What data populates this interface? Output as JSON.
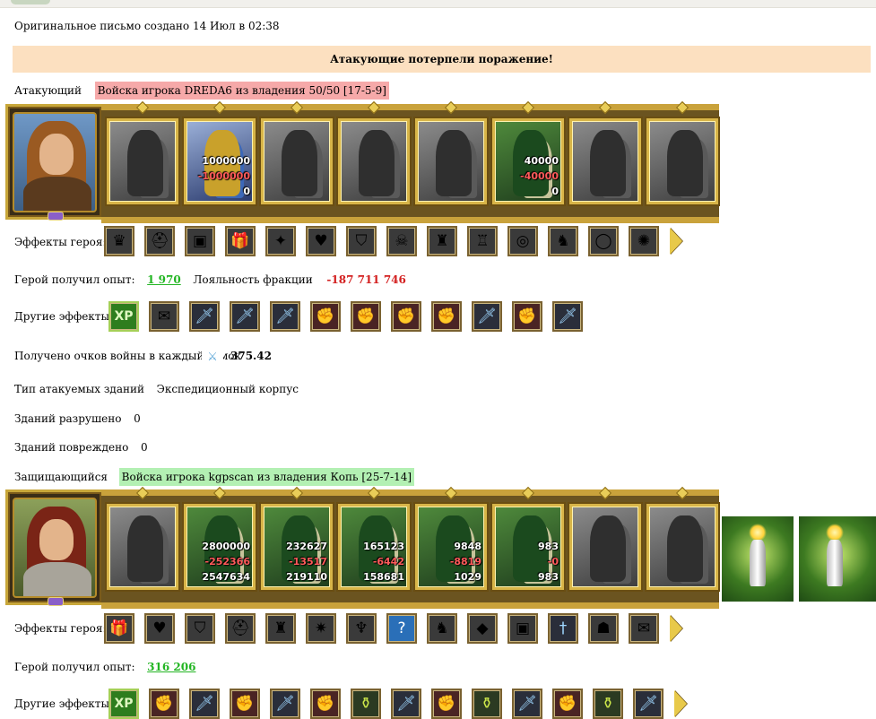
{
  "header": {
    "created": "Оригинальное письмо создано 14 Июл в 02:38"
  },
  "banner": {
    "text": "Атакующие потерпели поражение!"
  },
  "attacker": {
    "label": "Атакующий",
    "army": "Войска игрока DREDA6 из владения 50/50 [17-5-9]",
    "units": [
      {
        "style": "gray",
        "n1": "",
        "n2": "",
        "n3": ""
      },
      {
        "style": "yellow",
        "n1": "1000000",
        "n2": "-1000000",
        "n3": "0"
      },
      {
        "style": "gray",
        "n1": "",
        "n2": "",
        "n3": ""
      },
      {
        "style": "gray",
        "n1": "",
        "n2": "",
        "n3": ""
      },
      {
        "style": "gray",
        "n1": "",
        "n2": "",
        "n3": ""
      },
      {
        "style": "color",
        "n1": "40000",
        "n2": "-40000",
        "n3": "0"
      },
      {
        "style": "gray",
        "n1": "",
        "n2": "",
        "n3": ""
      },
      {
        "style": "gray",
        "n1": "",
        "n2": "",
        "n3": ""
      }
    ],
    "hero_effects_label": "Эффекты героя:",
    "hero_effect_icons": [
      "gem-crown-icon",
      "helmet-icon",
      "chest-icon",
      "gift-icon",
      "treasure-icon",
      "heart-icon",
      "shield-icon",
      "skull-icon",
      "armor-icon",
      "cuirass-icon",
      "ring-icon",
      "boots-icon",
      "bracelet-icon",
      "scarab-icon"
    ],
    "exp_label": "Герой получил опыт:",
    "exp_value": "1 970",
    "loyalty_label": "Лояльность фракции",
    "loyalty_value": "-187 711 746",
    "other_label": "Другие эффекты:",
    "other_icons": [
      "xp-icon",
      "scroll-icon",
      "sword-icon",
      "sword-icon",
      "sword-icon",
      "fist-icon",
      "fist-icon",
      "fist-icon",
      "fist-icon",
      "sword-icon",
      "fist-icon",
      "sword-icon"
    ],
    "war_points_label": "Получено очков войны в каждый замок",
    "war_points_value": "375.42",
    "building_type_label": "Тип атакуемых зданий",
    "building_type_value": "Экспедиционный корпус",
    "destroyed_label": "Зданий разрушено",
    "destroyed_value": "0",
    "damaged_label": "Зданий повреждено",
    "damaged_value": "0"
  },
  "defender": {
    "label": "Защищающийся",
    "army": "Войска игрока kgpscan из владения Копь [25-7-14]",
    "units": [
      {
        "style": "gray",
        "n1": "",
        "n2": "",
        "n3": ""
      },
      {
        "style": "color",
        "n1": "2800000",
        "n2": "-252366",
        "n3": "2547634"
      },
      {
        "style": "color",
        "n1": "232627",
        "n2": "-13517",
        "n3": "219110"
      },
      {
        "style": "color",
        "n1": "165123",
        "n2": "-6442",
        "n3": "158681"
      },
      {
        "style": "color",
        "n1": "9848",
        "n2": "-8819",
        "n3": "1029"
      },
      {
        "style": "color",
        "n1": "983",
        "n2": "-0",
        "n3": "983"
      },
      {
        "style": "gray",
        "n1": "",
        "n2": "",
        "n3": ""
      },
      {
        "style": "gray",
        "n1": "",
        "n2": "",
        "n3": ""
      }
    ],
    "hero_effects_label": "Эффекты героя:",
    "hero_effect_icons": [
      "gift-icon",
      "heart-icon",
      "shield-icon",
      "helmet-icon",
      "armor-icon",
      "star-icon",
      "crest-icon",
      "question-icon",
      "boots-icon",
      "amulet-icon",
      "chest-icon",
      "dagger-icon",
      "mask-icon",
      "scroll-icon"
    ],
    "exp_label": "Герой получил опыт:",
    "exp_value": "316 206",
    "other_label": "Другие эффекты:",
    "other_icons": [
      "xp-icon",
      "fist-icon",
      "sword-icon",
      "fist-icon",
      "sword-icon",
      "fist-icon",
      "flask-icon",
      "sword-icon",
      "fist-icon",
      "flask-icon",
      "sword-icon",
      "fist-icon",
      "flask-icon",
      "sword-icon"
    ]
  },
  "colors": {
    "banner": "#fce0c0",
    "attacker_hl": "#f6a9a9",
    "defender_hl": "#b3f0b3",
    "gain": "#22b522",
    "loss": "#d32020"
  }
}
